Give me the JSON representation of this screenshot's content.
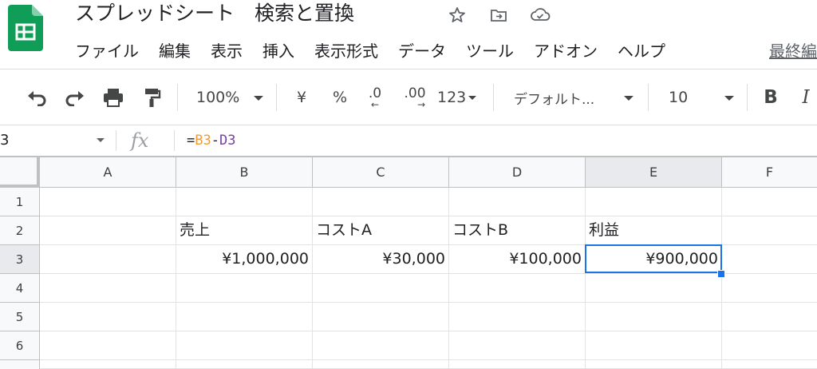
{
  "doc": {
    "title": "スプレッドシート　検索と置換",
    "last_edit": "最終編"
  },
  "menu": [
    "ファイル",
    "編集",
    "表示",
    "挿入",
    "表示形式",
    "データ",
    "ツール",
    "アドオン",
    "ヘルプ"
  ],
  "toolbar": {
    "zoom": "100%",
    "currency": "¥",
    "percent": "%",
    "decrease_decimal": ".0",
    "increase_decimal": ".00",
    "more_formats": "123",
    "font": "デフォルト...",
    "font_size": "10",
    "bold": "B",
    "italic": "I"
  },
  "formula_bar": {
    "cell_ref": "3",
    "fx": "fx",
    "eq": "=",
    "ref1": "B3",
    "op": "-",
    "ref2": "D3",
    "ref1_color": "#f29b34",
    "ref2_color": "#7b3fa0"
  },
  "columns": [
    "A",
    "B",
    "C",
    "D",
    "E",
    "F"
  ],
  "rows": [
    "1",
    "2",
    "3",
    "4",
    "5",
    "6"
  ],
  "cells": {
    "B2": "売上",
    "C2": "コストA",
    "D2": "コストB",
    "E2": "利益",
    "B3": "¥1,000,000",
    "C3": "¥30,000",
    "D3": "¥100,000",
    "E3": "¥900,000"
  },
  "colors": {
    "accent": "#1a73e8",
    "sheets_green": "#0f9d58"
  },
  "icons": [
    "star-icon",
    "move-to-folder-icon",
    "cloud-saved-icon",
    "undo-icon",
    "redo-icon",
    "print-icon",
    "paint-format-icon"
  ]
}
